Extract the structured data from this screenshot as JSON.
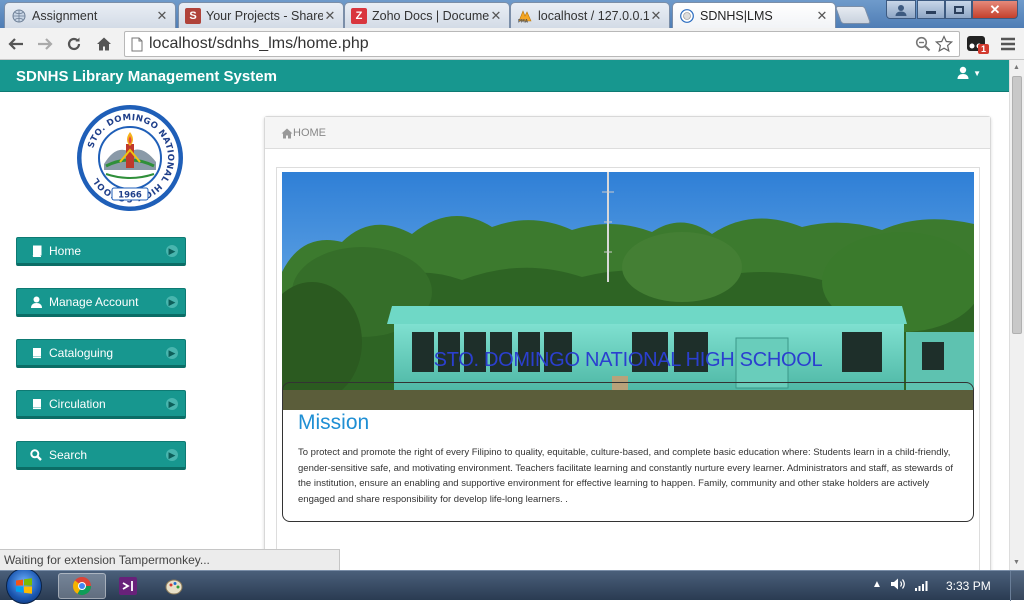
{
  "browser": {
    "tabs": [
      {
        "title": "Assignment",
        "icon": "globe-icon",
        "active": false
      },
      {
        "title": "Your Projects - Share",
        "icon": "s-logo-icon",
        "active": false
      },
      {
        "title": "Zoho Docs | Docume",
        "icon": "zoho-z-icon",
        "active": false
      },
      {
        "title": "localhost / 127.0.0.1",
        "icon": "phpmyadmin-icon",
        "active": false
      },
      {
        "title": "SDNHS|LMS",
        "icon": "school-seal-icon",
        "active": true
      }
    ],
    "url": "localhost/sdnhs_lms/home.php",
    "extension_badge": "1",
    "status_text": "Waiting for extension Tampermonkey..."
  },
  "app": {
    "brand": "SDNHS Library Management System",
    "sidebar": [
      {
        "label": "Home",
        "icon": "book-icon"
      },
      {
        "label": "Manage Account",
        "icon": "user-icon"
      },
      {
        "label": "Cataloguing",
        "icon": "book-icon"
      },
      {
        "label": "Circulation",
        "icon": "book-icon"
      },
      {
        "label": "Search",
        "icon": "search-icon"
      }
    ],
    "breadcrumb": "HOME",
    "school_name": "STO. DOMINGO NATIONAL HIGH SCHOOL",
    "logo": {
      "ring_text": "STO. DOMINGO NATIONAL HIGH SCHOOL",
      "year": "1966"
    },
    "mission": {
      "title": "Mission",
      "text": "To protect and promote the right of every Filipino to quality, equitable, culture-based, and complete basic education where: Students learn in a child-friendly, gender-sensitive safe, and motivating environment. Teachers facilitate learning and constantly nurture every learner. Administrators and staff, as stewards of the institution, ensure an enabling and supportive environment for effective learning to happen. Family, community and other stake holders are actively engaged and share responsibility for develop life-long learners. ."
    }
  },
  "taskbar": {
    "time": "3:33 PM"
  },
  "colors": {
    "teal": "#17978f",
    "school_name_blue": "#2b3fcf",
    "mission_blue": "#1f8fd4"
  }
}
